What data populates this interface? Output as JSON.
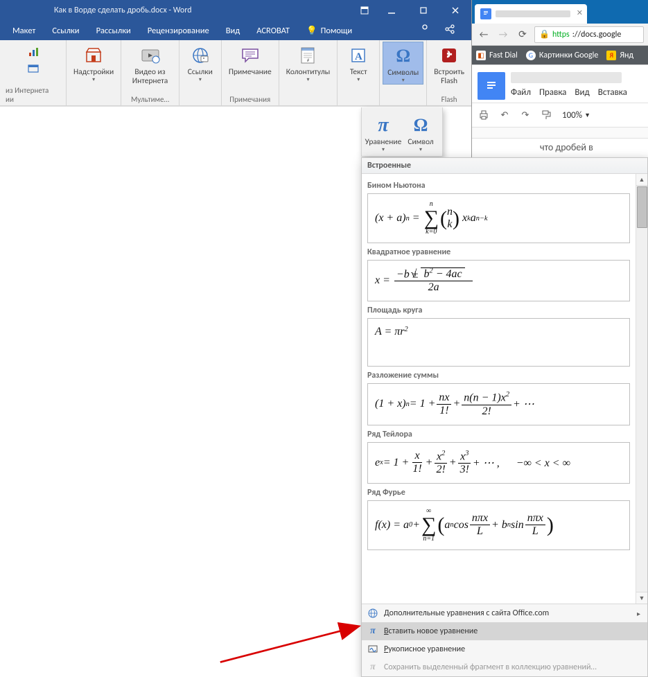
{
  "word": {
    "title": "Как в Ворде сделать дробь.docx - Word",
    "tabs": {
      "layout": "Макет",
      "references": "Ссылки",
      "mailings": "Рассылки",
      "review": "Рецензирование",
      "view": "Вид",
      "acrobat": "ACROBAT",
      "tell_me": "Помощи"
    },
    "ribbon": {
      "group_internet": "из Интернета",
      "group_info": "ии",
      "addins": "Надстройки",
      "video": "Видео из Интернета",
      "group_multimedia": "Мультиме…",
      "links": "Ссылки",
      "comment": "Примечание",
      "group_comments": "Примечания",
      "header_footer": "Колонтитулы",
      "text": "Текст",
      "symbols": "Символы",
      "embed_flash": "Встроить Flash",
      "group_flash": "Flash"
    },
    "eq_sub": {
      "equation": "Уравнение",
      "symbol": "Символ"
    },
    "eq_gallery": {
      "header": "Встроенные",
      "items": {
        "binom": "Бином Ньютона",
        "quad": "Квадратное уравнение",
        "circle": "Площадь круга",
        "expand": "Разложение суммы",
        "taylor": "Ряд Тейлора",
        "fourier": "Ряд Фурье"
      },
      "menu": {
        "more": "Дополнительные уравнения с сайта Office.com",
        "insert_new": "Вставить новое уравнение",
        "ink": "Рукописное уравнение",
        "save_sel": "Сохранить выделенный фрагмент в коллекцию уравнений…"
      }
    }
  },
  "browser": {
    "url_proto": "https",
    "url_rest": "://docs.google",
    "bookmarks": {
      "fastdial": "Fast Dial",
      "gimages": "Картинки Google",
      "yandex": "Янд"
    },
    "docs": {
      "menu": {
        "file": "Файл",
        "edit": "Правка",
        "view": "Вид",
        "insert": "Вставка"
      },
      "zoom": "100%",
      "page_text": "что дробей в"
    }
  }
}
